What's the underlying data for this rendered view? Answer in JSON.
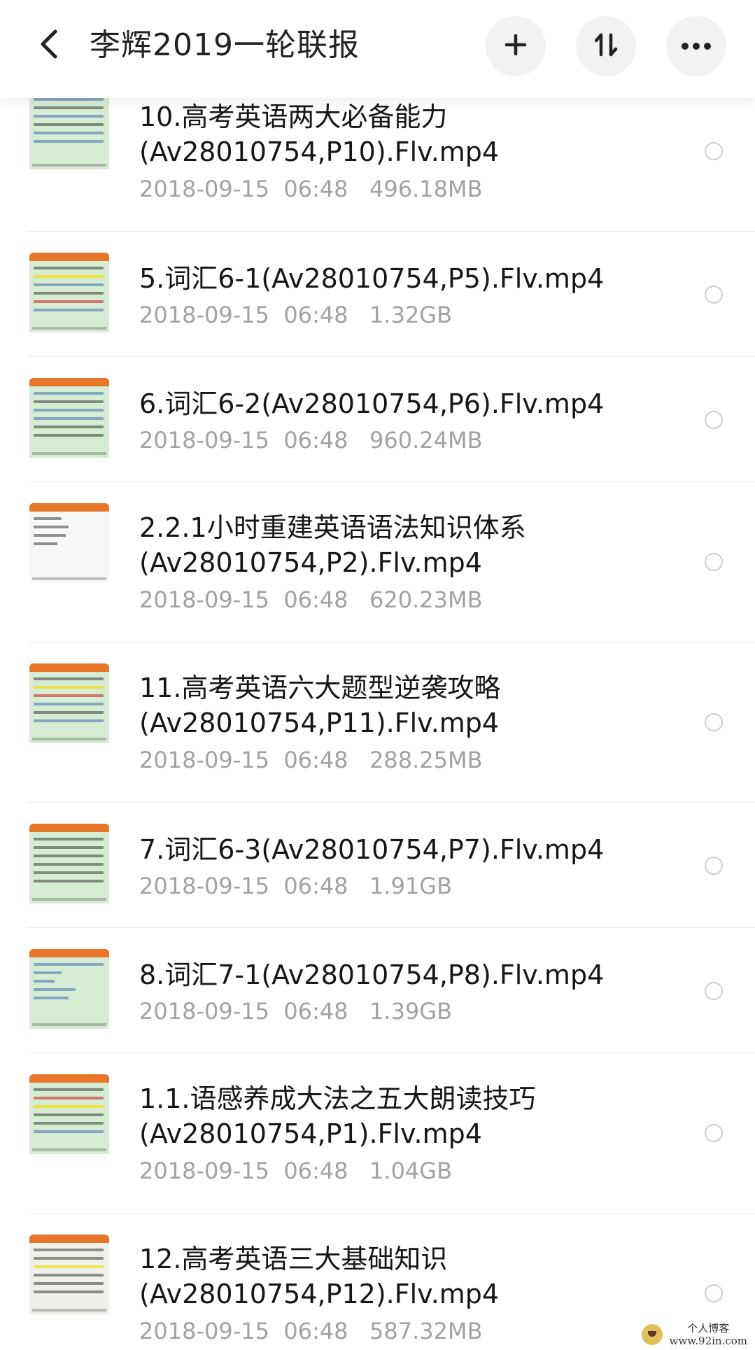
{
  "header": {
    "title": "李辉2019一轮联报",
    "back_icon": "chevron-left-icon",
    "add_icon": "plus-icon",
    "sort_icon": "sort-arrows-icon",
    "more_icon": "more-dots-icon"
  },
  "files": [
    {
      "name_lines": [
        "10.高考英语两大必备能力",
        "(Av28010754,P10).Flv.mp4"
      ],
      "date": "2018-09-15",
      "time": "06:48",
      "size": "496.18MB",
      "thumb": "green"
    },
    {
      "name_lines": [
        "5.词汇6-1(Av28010754,P5).Flv.mp4"
      ],
      "date": "2018-09-15",
      "time": "06:48",
      "size": "1.32GB",
      "thumb": "green"
    },
    {
      "name_lines": [
        "6.词汇6-2(Av28010754,P6).Flv.mp4"
      ],
      "date": "2018-09-15",
      "time": "06:48",
      "size": "960.24MB",
      "thumb": "green"
    },
    {
      "name_lines": [
        "2.2.1小时重建英语语法知识体系",
        "(Av28010754,P2).Flv.mp4"
      ],
      "date": "2018-09-15",
      "time": "06:48",
      "size": "620.23MB",
      "thumb": "white"
    },
    {
      "name_lines": [
        "11.高考英语六大题型逆袭攻略",
        "(Av28010754,P11).Flv.mp4"
      ],
      "date": "2018-09-15",
      "time": "06:48",
      "size": "288.25MB",
      "thumb": "green"
    },
    {
      "name_lines": [
        "7.词汇6-3(Av28010754,P7).Flv.mp4"
      ],
      "date": "2018-09-15",
      "time": "06:48",
      "size": "1.91GB",
      "thumb": "green"
    },
    {
      "name_lines": [
        "8.词汇7-1(Av28010754,P8).Flv.mp4"
      ],
      "date": "2018-09-15",
      "time": "06:48",
      "size": "1.39GB",
      "thumb": "green"
    },
    {
      "name_lines": [
        "1.1.语感养成大法之五大朗读技巧",
        "(Av28010754,P1).Flv.mp4"
      ],
      "date": "2018-09-15",
      "time": "06:48",
      "size": "1.04GB",
      "thumb": "green"
    },
    {
      "name_lines": [
        "12.高考英语三大基础知识",
        "(Av28010754,P12).Flv.mp4"
      ],
      "date": "2018-09-15",
      "time": "06:48",
      "size": "587.32MB",
      "thumb": "grid"
    }
  ],
  "watermark": {
    "line1": "个人博客",
    "line2": "www.92in.com"
  },
  "colors": {
    "thumb_bar": "#e8762a",
    "meta_text": "#a2a2a2",
    "header_button_bg": "#f2f2f2"
  }
}
